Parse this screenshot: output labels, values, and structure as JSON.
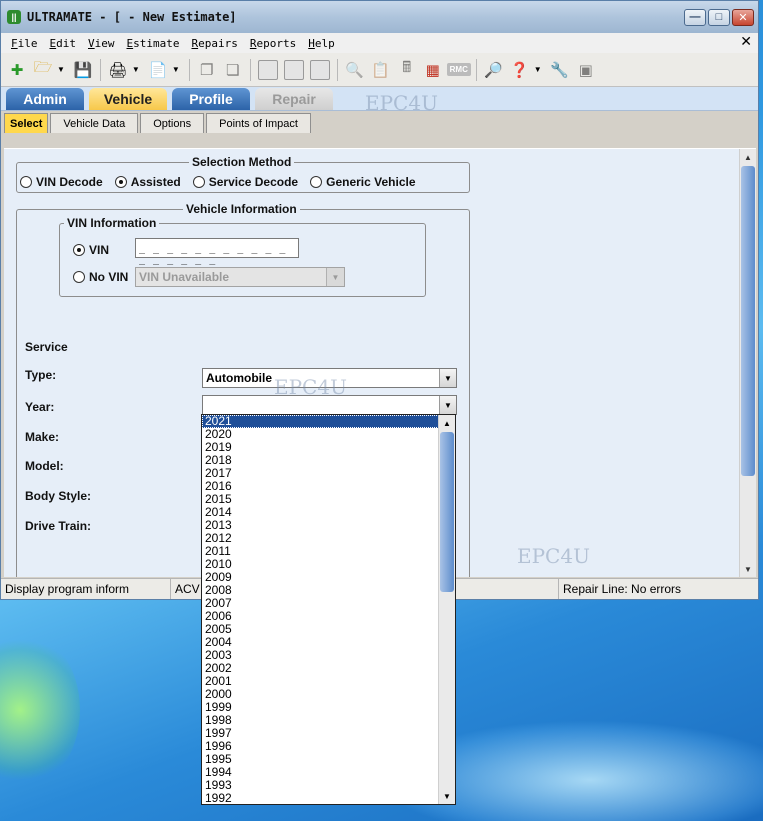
{
  "window": {
    "title": "ULTRAMATE - [ - New Estimate]"
  },
  "menu": [
    "File",
    "Edit",
    "View",
    "Estimate",
    "Repairs",
    "Reports",
    "Help"
  ],
  "main_tabs": [
    {
      "label": "Admin",
      "state": "normal"
    },
    {
      "label": "Vehicle",
      "state": "active"
    },
    {
      "label": "Profile",
      "state": "normal"
    },
    {
      "label": "Repair",
      "state": "disabled"
    }
  ],
  "watermark": "EPC4U",
  "sub_tabs": [
    "Select",
    "Vehicle Data",
    "Options",
    "Points of Impact"
  ],
  "selection_method": {
    "legend": "Selection Method",
    "options": [
      "VIN Decode",
      "Assisted",
      "Service Decode",
      "Generic Vehicle"
    ],
    "selected": "Assisted"
  },
  "vehicle_info": {
    "legend": "Vehicle Information",
    "vin_legend": "VIN Information",
    "vin_label": "VIN",
    "vin_value": "_ _ _ _ _ _ _ _ _ _ _ _ _ _ _ _ _",
    "novin_label": "No VIN",
    "novin_value": "VIN Unavailable"
  },
  "form": {
    "service_label": "Service",
    "type_label": "Type:",
    "type_value": "Automobile",
    "year_label": "Year:",
    "year_value": "",
    "make_label": "Make:",
    "model_label": "Model:",
    "body_label": "Body Style:",
    "drive_label": "Drive Train:"
  },
  "year_options": [
    "2021",
    "2020",
    "2019",
    "2018",
    "2017",
    "2016",
    "2015",
    "2014",
    "2013",
    "2012",
    "2011",
    "2010",
    "2009",
    "2008",
    "2007",
    "2006",
    "2005",
    "2004",
    "2003",
    "2002",
    "2001",
    "2000",
    "1999",
    "1998",
    "1997",
    "1996",
    "1995",
    "1994",
    "1993",
    "1992"
  ],
  "year_highlighted": "2021",
  "status": {
    "left": "Display program inform",
    "mid": "ACV",
    "right": "Repair Line: No errors"
  },
  "colors": {
    "active_tab": "#f7c84a",
    "tab_blue": "#2c63a8",
    "selection": "#1f4f99"
  }
}
